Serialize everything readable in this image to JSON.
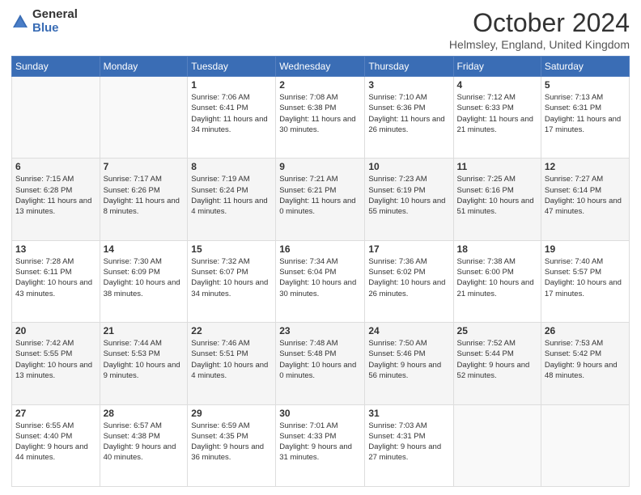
{
  "header": {
    "logo_general": "General",
    "logo_blue": "Blue",
    "month_title": "October 2024",
    "location": "Helmsley, England, United Kingdom"
  },
  "days_of_week": [
    "Sunday",
    "Monday",
    "Tuesday",
    "Wednesday",
    "Thursday",
    "Friday",
    "Saturday"
  ],
  "weeks": [
    [
      {
        "day": "",
        "sunrise": "",
        "sunset": "",
        "daylight": ""
      },
      {
        "day": "",
        "sunrise": "",
        "sunset": "",
        "daylight": ""
      },
      {
        "day": "1",
        "sunrise": "Sunrise: 7:06 AM",
        "sunset": "Sunset: 6:41 PM",
        "daylight": "Daylight: 11 hours and 34 minutes."
      },
      {
        "day": "2",
        "sunrise": "Sunrise: 7:08 AM",
        "sunset": "Sunset: 6:38 PM",
        "daylight": "Daylight: 11 hours and 30 minutes."
      },
      {
        "day": "3",
        "sunrise": "Sunrise: 7:10 AM",
        "sunset": "Sunset: 6:36 PM",
        "daylight": "Daylight: 11 hours and 26 minutes."
      },
      {
        "day": "4",
        "sunrise": "Sunrise: 7:12 AM",
        "sunset": "Sunset: 6:33 PM",
        "daylight": "Daylight: 11 hours and 21 minutes."
      },
      {
        "day": "5",
        "sunrise": "Sunrise: 7:13 AM",
        "sunset": "Sunset: 6:31 PM",
        "daylight": "Daylight: 11 hours and 17 minutes."
      }
    ],
    [
      {
        "day": "6",
        "sunrise": "Sunrise: 7:15 AM",
        "sunset": "Sunset: 6:28 PM",
        "daylight": "Daylight: 11 hours and 13 minutes."
      },
      {
        "day": "7",
        "sunrise": "Sunrise: 7:17 AM",
        "sunset": "Sunset: 6:26 PM",
        "daylight": "Daylight: 11 hours and 8 minutes."
      },
      {
        "day": "8",
        "sunrise": "Sunrise: 7:19 AM",
        "sunset": "Sunset: 6:24 PM",
        "daylight": "Daylight: 11 hours and 4 minutes."
      },
      {
        "day": "9",
        "sunrise": "Sunrise: 7:21 AM",
        "sunset": "Sunset: 6:21 PM",
        "daylight": "Daylight: 11 hours and 0 minutes."
      },
      {
        "day": "10",
        "sunrise": "Sunrise: 7:23 AM",
        "sunset": "Sunset: 6:19 PM",
        "daylight": "Daylight: 10 hours and 55 minutes."
      },
      {
        "day": "11",
        "sunrise": "Sunrise: 7:25 AM",
        "sunset": "Sunset: 6:16 PM",
        "daylight": "Daylight: 10 hours and 51 minutes."
      },
      {
        "day": "12",
        "sunrise": "Sunrise: 7:27 AM",
        "sunset": "Sunset: 6:14 PM",
        "daylight": "Daylight: 10 hours and 47 minutes."
      }
    ],
    [
      {
        "day": "13",
        "sunrise": "Sunrise: 7:28 AM",
        "sunset": "Sunset: 6:11 PM",
        "daylight": "Daylight: 10 hours and 43 minutes."
      },
      {
        "day": "14",
        "sunrise": "Sunrise: 7:30 AM",
        "sunset": "Sunset: 6:09 PM",
        "daylight": "Daylight: 10 hours and 38 minutes."
      },
      {
        "day": "15",
        "sunrise": "Sunrise: 7:32 AM",
        "sunset": "Sunset: 6:07 PM",
        "daylight": "Daylight: 10 hours and 34 minutes."
      },
      {
        "day": "16",
        "sunrise": "Sunrise: 7:34 AM",
        "sunset": "Sunset: 6:04 PM",
        "daylight": "Daylight: 10 hours and 30 minutes."
      },
      {
        "day": "17",
        "sunrise": "Sunrise: 7:36 AM",
        "sunset": "Sunset: 6:02 PM",
        "daylight": "Daylight: 10 hours and 26 minutes."
      },
      {
        "day": "18",
        "sunrise": "Sunrise: 7:38 AM",
        "sunset": "Sunset: 6:00 PM",
        "daylight": "Daylight: 10 hours and 21 minutes."
      },
      {
        "day": "19",
        "sunrise": "Sunrise: 7:40 AM",
        "sunset": "Sunset: 5:57 PM",
        "daylight": "Daylight: 10 hours and 17 minutes."
      }
    ],
    [
      {
        "day": "20",
        "sunrise": "Sunrise: 7:42 AM",
        "sunset": "Sunset: 5:55 PM",
        "daylight": "Daylight: 10 hours and 13 minutes."
      },
      {
        "day": "21",
        "sunrise": "Sunrise: 7:44 AM",
        "sunset": "Sunset: 5:53 PM",
        "daylight": "Daylight: 10 hours and 9 minutes."
      },
      {
        "day": "22",
        "sunrise": "Sunrise: 7:46 AM",
        "sunset": "Sunset: 5:51 PM",
        "daylight": "Daylight: 10 hours and 4 minutes."
      },
      {
        "day": "23",
        "sunrise": "Sunrise: 7:48 AM",
        "sunset": "Sunset: 5:48 PM",
        "daylight": "Daylight: 10 hours and 0 minutes."
      },
      {
        "day": "24",
        "sunrise": "Sunrise: 7:50 AM",
        "sunset": "Sunset: 5:46 PM",
        "daylight": "Daylight: 9 hours and 56 minutes."
      },
      {
        "day": "25",
        "sunrise": "Sunrise: 7:52 AM",
        "sunset": "Sunset: 5:44 PM",
        "daylight": "Daylight: 9 hours and 52 minutes."
      },
      {
        "day": "26",
        "sunrise": "Sunrise: 7:53 AM",
        "sunset": "Sunset: 5:42 PM",
        "daylight": "Daylight: 9 hours and 48 minutes."
      }
    ],
    [
      {
        "day": "27",
        "sunrise": "Sunrise: 6:55 AM",
        "sunset": "Sunset: 4:40 PM",
        "daylight": "Daylight: 9 hours and 44 minutes."
      },
      {
        "day": "28",
        "sunrise": "Sunrise: 6:57 AM",
        "sunset": "Sunset: 4:38 PM",
        "daylight": "Daylight: 9 hours and 40 minutes."
      },
      {
        "day": "29",
        "sunrise": "Sunrise: 6:59 AM",
        "sunset": "Sunset: 4:35 PM",
        "daylight": "Daylight: 9 hours and 36 minutes."
      },
      {
        "day": "30",
        "sunrise": "Sunrise: 7:01 AM",
        "sunset": "Sunset: 4:33 PM",
        "daylight": "Daylight: 9 hours and 31 minutes."
      },
      {
        "day": "31",
        "sunrise": "Sunrise: 7:03 AM",
        "sunset": "Sunset: 4:31 PM",
        "daylight": "Daylight: 9 hours and 27 minutes."
      },
      {
        "day": "",
        "sunrise": "",
        "sunset": "",
        "daylight": ""
      },
      {
        "day": "",
        "sunrise": "",
        "sunset": "",
        "daylight": ""
      }
    ]
  ]
}
